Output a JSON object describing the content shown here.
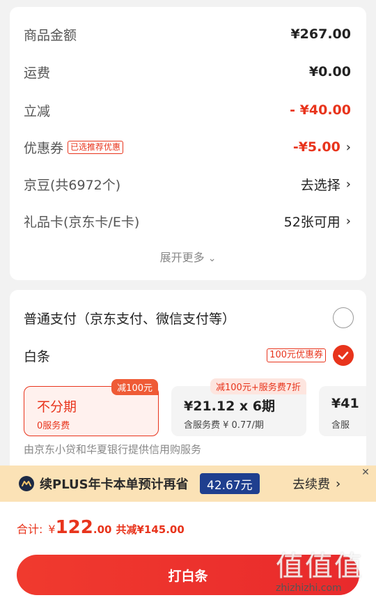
{
  "summary": {
    "rows": [
      {
        "label": "商品金额",
        "value": "¥267.00"
      },
      {
        "label": "运费",
        "value": "¥0.00"
      },
      {
        "label": "立减",
        "value": "- ¥40.00"
      },
      {
        "label": "优惠券",
        "tag": "已选推荐优惠",
        "value": "-¥5.00"
      },
      {
        "label": "京豆(共6972个)",
        "value": "去选择"
      },
      {
        "label": "礼品卡(京东卡/E卡)",
        "value": "52张可用"
      }
    ],
    "expand_label": "展开更多",
    "chevron": "›",
    "chevron_down": "⌄"
  },
  "payment": {
    "normal_label": "普通支付（京东支付、微信支付等）",
    "baitiao_label": "白条",
    "baitiao_tag": "100元优惠券",
    "plans": [
      {
        "title": "不分期",
        "sub": "0服务费",
        "badge": "减100元",
        "selected": true
      },
      {
        "title": "¥21.12 x 6期",
        "sub": "含服务费 ¥ 0.77/期",
        "badge": "减100元+服务费7折"
      },
      {
        "title": "¥41",
        "sub": "含服"
      }
    ],
    "note": "由京东小贷和华夏银行提供信用购服务"
  },
  "plus": {
    "text": "续PLUS年卡本单预计再省",
    "save": "42.67元",
    "renew": "去续费",
    "chevron": "›",
    "close": "✕"
  },
  "checkout": {
    "total_label": "合计:",
    "yen": "¥",
    "total_int": "122",
    "total_dec": ".00",
    "saved": "共减¥145.00",
    "button": "打白条"
  },
  "watermark": {
    "big": "值值值",
    "small": "zhizhizhi.com"
  },
  "colors": {
    "accent": "#e8341c",
    "plus_bg": "#fbe2b6",
    "plus_badge": "#1f3f8f"
  }
}
